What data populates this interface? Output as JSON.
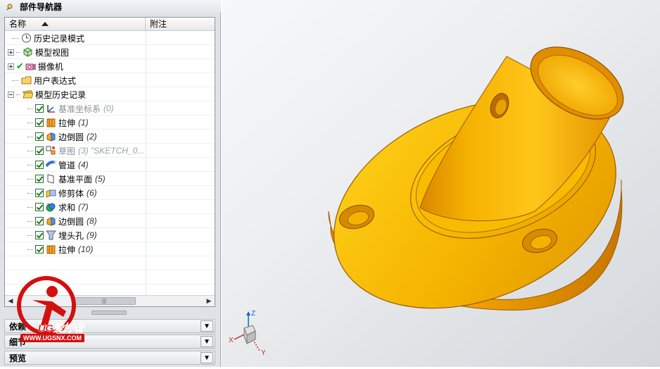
{
  "navigator": {
    "title": "部件导航器",
    "columns": {
      "name": "名称",
      "note": "附注"
    },
    "rows": [
      {
        "label": "历史记录模式",
        "number": ""
      },
      {
        "label": "模型视图",
        "number": ""
      },
      {
        "label": "摄像机",
        "number": ""
      },
      {
        "label": "用户表达式",
        "number": ""
      },
      {
        "label": "模型历史记录",
        "number": ""
      },
      {
        "label": "基准坐标系",
        "number": "(0)"
      },
      {
        "label": "拉伸",
        "number": "(1)"
      },
      {
        "label": "边倒圆",
        "number": "(2)"
      },
      {
        "label": "草图",
        "number": "(3) \"SKETCH_0..."
      },
      {
        "label": "管道",
        "number": "(4)"
      },
      {
        "label": "基准平面",
        "number": "(5)"
      },
      {
        "label": "修剪体",
        "number": "(6)"
      },
      {
        "label": "求和",
        "number": "(7)"
      },
      {
        "label": "边倒圆",
        "number": "(8)"
      },
      {
        "label": "埋头孔",
        "number": "(9)"
      },
      {
        "label": "拉伸",
        "number": "(10)"
      }
    ],
    "scroll_thumb": "|||",
    "sections": [
      {
        "label": "依赖"
      },
      {
        "label": "细节"
      },
      {
        "label": "预览"
      }
    ]
  },
  "watermark": {
    "brand": "UG爱好者",
    "url": "WWW.UGSNX.COM"
  },
  "triad": {
    "z": "Z",
    "x": "X",
    "y": "Y"
  },
  "colors": {
    "part": "#f5b400",
    "accent": "#d40f0f"
  }
}
